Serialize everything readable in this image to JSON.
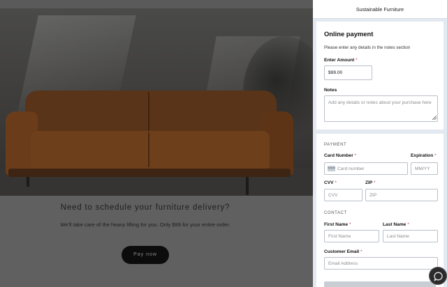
{
  "background": {
    "heading": "Need to schedule your furniture delivery?",
    "subtext": "We'll take care of the heavy lifting for you.  Only $99 for your entire order.",
    "pay_button": "Pay now"
  },
  "panel": {
    "header_title": "Sustainable Furniture",
    "payment_card": {
      "title": "Online payment",
      "hint": "Please enter any details in the notes section",
      "amount_label": "Enter Amount",
      "amount_value": "$99.00",
      "notes_label": "Notes",
      "notes_placeholder": "Add any details or notes about your purchase here"
    },
    "details_card": {
      "payment_section": "PAYMENT",
      "card_number_label": "Card Number",
      "card_number_placeholder": "Card number",
      "expiration_label": "Expiration",
      "expiration_placeholder": "MM/YY",
      "cvv_label": "CVV",
      "cvv_placeholder": "CVV",
      "zip_label": "ZIP",
      "zip_placeholder": "ZIP",
      "contact_section": "CONTACT",
      "first_name_label": "First Name",
      "first_name_placeholder": "First Name",
      "last_name_label": "Last Name",
      "last_name_placeholder": "Last Name",
      "email_label": "Customer Email",
      "email_placeholder": "Email Address"
    },
    "required_marker": "*"
  },
  "icons": {
    "card": "credit-card-icon",
    "chat": "chat-bubble-icon",
    "resize": "resize-handle-icon"
  },
  "colors": {
    "required": "#d32f2f",
    "pay_button_bg": "#0c0c0c",
    "panel_bg": "#e3e9f0"
  }
}
